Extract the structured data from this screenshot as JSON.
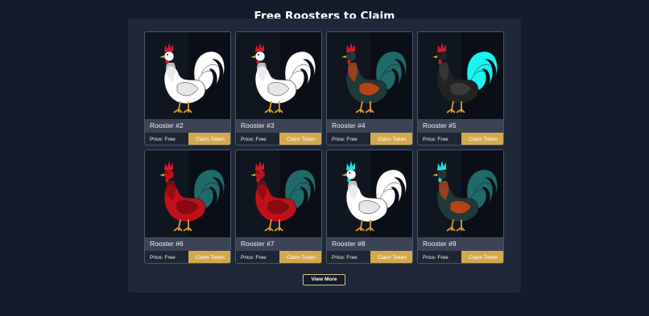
{
  "title": "Free Roosters to Claim",
  "claim_label": "Claim Token",
  "view_more_label": "View More",
  "roosters": [
    {
      "name": "Rooster #2",
      "price": "Price: Free",
      "body": "#ffffff",
      "tail": "#ffffff",
      "comb": "#d01a2a",
      "wing": "#e6e6e6"
    },
    {
      "name": "Rooster #3",
      "price": "Price: Free",
      "body": "#ffffff",
      "tail": "#ffffff",
      "comb": "#d01a2a",
      "wing": "#e6e6e6"
    },
    {
      "name": "Rooster #4",
      "price": "Price: Free",
      "body": "#1f3a38",
      "tail": "#1f6a6a",
      "comb": "#d01a2a",
      "wing": "#b4431a"
    },
    {
      "name": "Rooster #5",
      "price": "Price: Free",
      "body": "#222222",
      "tail": "#19f5f0",
      "comb": "#d01a2a",
      "wing": "#3a3a3a"
    },
    {
      "name": "Rooster #6",
      "price": "Price: Free",
      "body": "#c0101a",
      "tail": "#1f6a6a",
      "comb": "#d01a2a",
      "wing": "#8a0a12"
    },
    {
      "name": "Rooster #7",
      "price": "Price: Free",
      "body": "#c0101a",
      "tail": "#1f6a6a",
      "comb": "#d01a2a",
      "wing": "#8a0a12"
    },
    {
      "name": "Rooster #8",
      "price": "Price: Free",
      "body": "#ffffff",
      "tail": "#ffffff",
      "comb": "#19e0e0",
      "wing": "#e6e6e6"
    },
    {
      "name": "Rooster #9",
      "price": "Price: Free",
      "body": "#1f3a38",
      "tail": "#1f6a6a",
      "comb": "#19e0e0",
      "wing": "#b4431a"
    }
  ],
  "colors": {
    "accent": "#d4a94e",
    "background": "#141b2b",
    "panel": "#1f2839"
  }
}
